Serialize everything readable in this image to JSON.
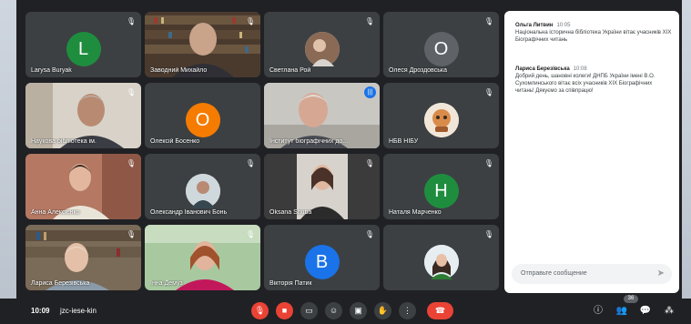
{
  "participants": [
    {
      "name": "Larysa Buryak",
      "avatar_letter": "L",
      "avatar_color": "#1e8e3e",
      "camera": false,
      "muted": true
    },
    {
      "name": "Заводний Михайло",
      "camera": true,
      "muted": true
    },
    {
      "name": "Светлана Рой",
      "camera": false,
      "avatar_image": true,
      "muted": true
    },
    {
      "name": "Олеся Дроздовська",
      "avatar_letter": "О",
      "avatar_color": "#5f6368",
      "camera": false,
      "muted": true
    },
    {
      "name": "Наукова бібліотека ім.",
      "camera": true,
      "muted": true
    },
    {
      "name": "Олексій Босенко",
      "avatar_letter": "О",
      "avatar_color": "#f57c00",
      "camera": false,
      "muted": false
    },
    {
      "name": "Інститут біографічних до...",
      "camera": true,
      "active_speaker": true,
      "muted": false
    },
    {
      "name": "НБВ НІБУ",
      "camera": false,
      "avatar_image": true,
      "muted": true
    },
    {
      "name": "Анна Алексієнко",
      "camera": true,
      "muted": true
    },
    {
      "name": "Олександр Іванович Бонь",
      "camera": false,
      "avatar_image": true,
      "muted": true
    },
    {
      "name": "Oksana Shuba",
      "camera": true,
      "muted": true
    },
    {
      "name": "Наталя Марченко",
      "avatar_letter": "Н",
      "avatar_color": "#1e8e3e",
      "camera": false,
      "muted": true
    },
    {
      "name": "Лариса Березівська",
      "camera": true,
      "muted": true
    },
    {
      "name": "Інна Демуз",
      "camera": true,
      "muted": true
    },
    {
      "name": "Вікторія Патик",
      "avatar_letter": "В",
      "avatar_color": "#1a73e8",
      "camera": false,
      "muted": true
    },
    {
      "name": "",
      "camera": false,
      "avatar_image": true,
      "muted": true
    }
  ],
  "chat": {
    "messages": [
      {
        "sender": "Ольга Литвин",
        "time": "10:05",
        "text": "Національна історична бібліотека України вітає учасників XIX Біографічних читань"
      },
      {
        "sender": "Лариса Березівська",
        "time": "10:08",
        "text": "Добрий день, шановні колеги! ДНПБ України імені В.О. Сухомлинського вітає всіх учасників XIX Біографічних читань! Дякуємо за співпрацю!"
      }
    ],
    "input_placeholder": "Отправьте сообщение"
  },
  "bottom_bar": {
    "time": "10:09",
    "meeting_code": "jzc-iese-kin",
    "participant_count": "36"
  },
  "icons": {
    "mic_off": "mic-off-icon",
    "cam_off": "camera-off-icon",
    "captions": "captions-icon",
    "emoji": "emoji-icon",
    "present": "present-icon",
    "raise_hand": "raise-hand-icon",
    "more": "more-options-icon",
    "end_call": "end-call-icon",
    "info": "info-icon",
    "people": "people-icon",
    "chat": "chat-icon",
    "activities": "activities-icon",
    "send": "send-icon"
  },
  "colors": {
    "background": "#202124",
    "tile": "#3c4043",
    "danger": "#ea4335",
    "accent": "#1a73e8"
  }
}
